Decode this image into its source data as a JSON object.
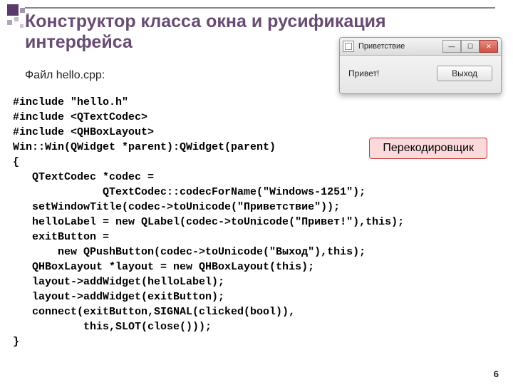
{
  "title": "Конструктор класса окна и русификация интерфейса",
  "file_label": "Файл hello.cpp:",
  "code_lines": [
    "#include \"hello.h\"",
    "#include <QTextCodec>",
    "#include <QHBoxLayout>",
    "Win::Win(QWidget *parent):QWidget(parent)",
    "{",
    "   QTextCodec *codec =",
    "              QTextCodec::codecForName(\"Windows-1251\");",
    "   setWindowTitle(codec->toUnicode(\"Приветствие\"));",
    "   helloLabel = new QLabel(codec->toUnicode(\"Привет!\"),this);",
    "   exitButton =",
    "       new QPushButton(codec->toUnicode(\"Выход\"),this);",
    "   QHBoxLayout *layout = new QHBoxLayout(this);",
    "   layout->addWidget(helloLabel);",
    "   layout->addWidget(exitButton);",
    "   connect(exitButton,SIGNAL(clicked(bool)),",
    "           this,SLOT(close()));",
    "}"
  ],
  "window": {
    "title": "Приветствие",
    "label": "Привет!",
    "exit_button": "Выход",
    "min_glyph": "—",
    "max_glyph": "☐",
    "close_glyph": "✕"
  },
  "callout": "Перекодировщик",
  "page_number": "6"
}
